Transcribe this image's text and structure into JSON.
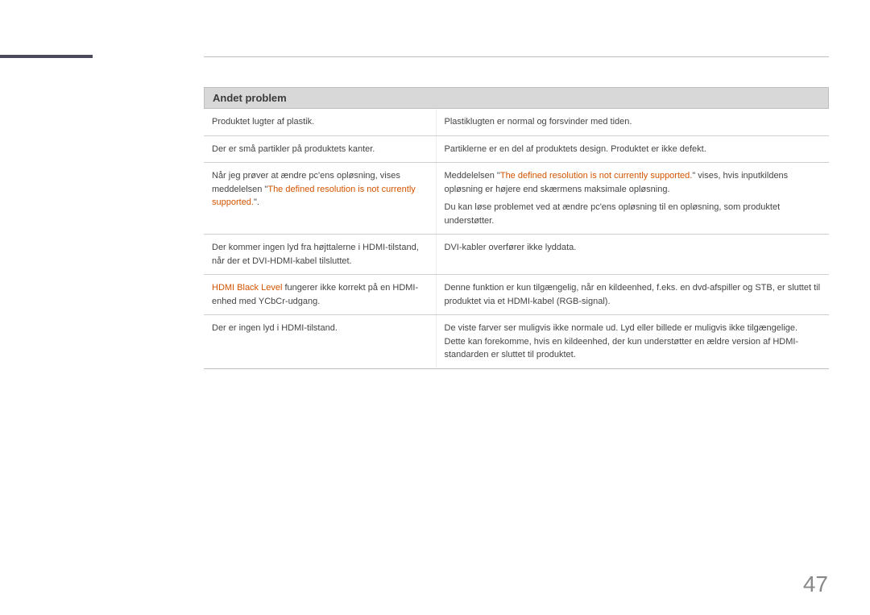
{
  "section_header": "Andet problem",
  "rows": [
    {
      "left": [
        {
          "t": "Produktet lugter af plastik."
        }
      ],
      "right": [
        {
          "t": "Plastiklugten er normal og forsvinder med tiden."
        }
      ]
    },
    {
      "left": [
        {
          "t": "Der er små partikler på produktets kanter."
        }
      ],
      "right": [
        {
          "t": "Partiklerne er en del af produktets design. Produktet er ikke defekt."
        }
      ]
    },
    {
      "left": [
        {
          "t": "Når jeg prøver at ændre pc'ens opløsning, vises meddelelsen \""
        },
        {
          "t": "The defined resolution is not currently supported.",
          "c": "orange"
        },
        {
          "t": "\"."
        }
      ],
      "right_paras": [
        [
          {
            "t": "Meddelelsen \""
          },
          {
            "t": "The defined resolution is not currently supported.",
            "c": "orange"
          },
          {
            "t": "\" vises, hvis inputkildens opløsning er højere end skærmens maksimale opløsning."
          }
        ],
        [
          {
            "t": "Du kan løse problemet ved at ændre pc'ens opløsning til en opløsning, som produktet understøtter."
          }
        ]
      ]
    },
    {
      "left": [
        {
          "t": "Der kommer ingen lyd fra højttalerne i HDMI-tilstand, når der et DVI-HDMI-kabel tilsluttet."
        }
      ],
      "right": [
        {
          "t": "DVI-kabler overfører ikke lyddata."
        }
      ]
    },
    {
      "left": [
        {
          "t": "HDMI Black Level",
          "c": "orange"
        },
        {
          "t": " fungerer ikke korrekt på en HDMI-enhed med YCbCr-udgang."
        }
      ],
      "right": [
        {
          "t": "Denne funktion er kun tilgængelig, når en kildeenhed, f.eks. en dvd-afspiller og STB, er sluttet til produktet via et HDMI-kabel (RGB-signal)."
        }
      ]
    },
    {
      "left": [
        {
          "t": "Der er ingen lyd i HDMI-tilstand."
        }
      ],
      "right": [
        {
          "t": "De viste farver ser muligvis ikke normale ud. Lyd eller billede er muligvis ikke tilgængelige. Dette kan forekomme, hvis en kildeenhed, der kun understøtter en ældre version af HDMI-standarden er sluttet til produktet."
        }
      ]
    }
  ],
  "page_number": "47"
}
